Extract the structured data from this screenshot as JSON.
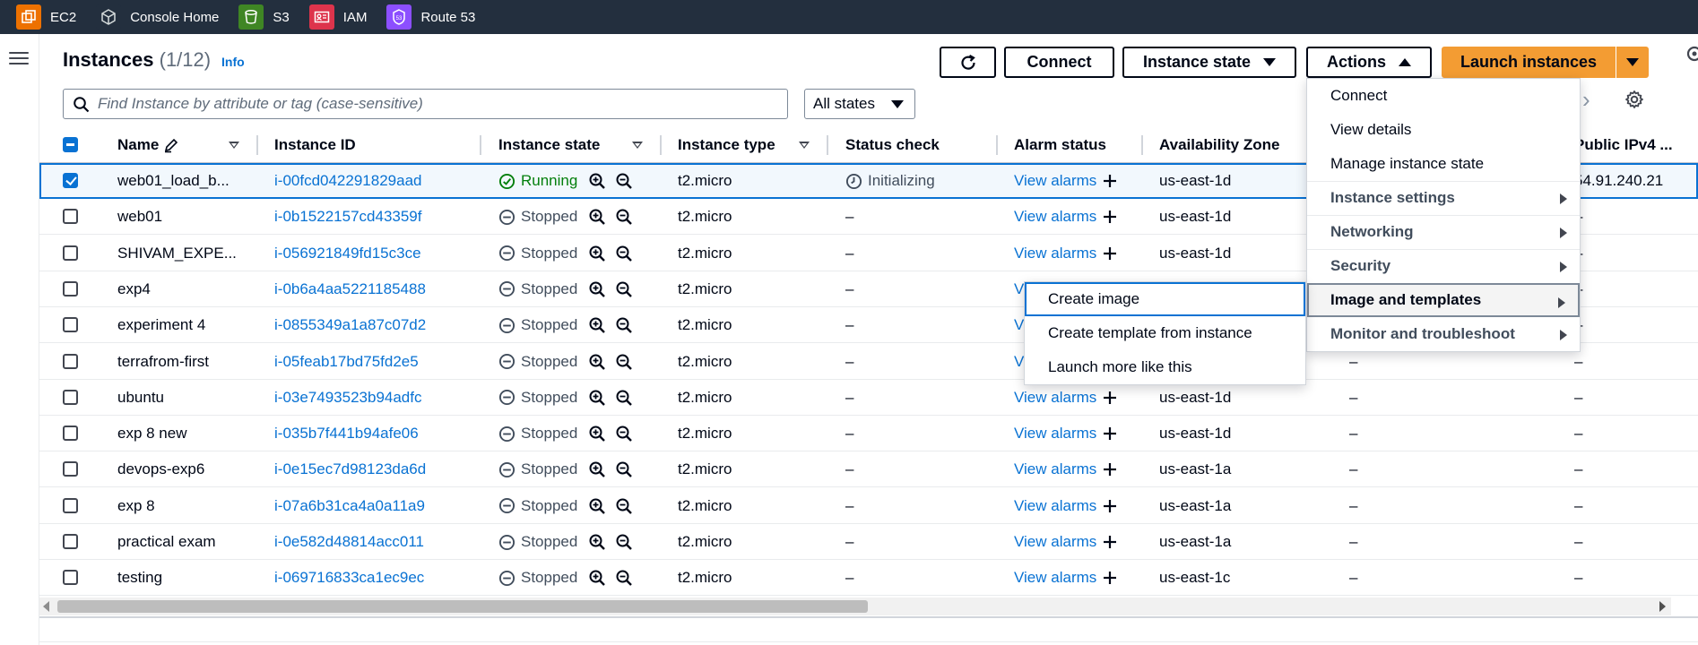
{
  "favorites": [
    {
      "label": "EC2",
      "icon": "ec2-icon",
      "color": "#ed7100"
    },
    {
      "label": "Console Home",
      "icon": "console-home-icon",
      "color": "#232f3e"
    },
    {
      "label": "S3",
      "icon": "s3-icon",
      "color": "#3f8624"
    },
    {
      "label": "IAM",
      "icon": "iam-icon",
      "color": "#dd344c"
    },
    {
      "label": "Route 53",
      "icon": "route53-icon",
      "color": "#8c4fff"
    }
  ],
  "header": {
    "title": "Instances",
    "count": "(1/12)",
    "info": "Info",
    "connect": "Connect",
    "instance_state": "Instance state",
    "actions": "Actions",
    "launch": "Launch instances"
  },
  "search": {
    "placeholder": "Find Instance by attribute or tag (case-sensitive)"
  },
  "filter": {
    "selected": "All states"
  },
  "columns": [
    "Name",
    "Instance ID",
    "Instance state",
    "Instance type",
    "Status check",
    "Alarm status",
    "Availability Zone",
    "Public IPv4 ..."
  ],
  "rows": [
    {
      "name": "web01_load_b...",
      "id": "i-00fcd042291829aad",
      "state": "Running",
      "type": "t2.micro",
      "status": "Initializing",
      "alarm": "View alarms",
      "az": "us-east-1d",
      "ip": "54.91.240.21",
      "selected": true
    },
    {
      "name": "web01",
      "id": "i-0b1522157cd43359f",
      "state": "Stopped",
      "type": "t2.micro",
      "status": "–",
      "alarm": "View alarms",
      "az": "us-east-1d",
      "ip": "–"
    },
    {
      "name": "SHIVAM_EXPE...",
      "id": "i-056921849fd15c3ce",
      "state": "Stopped",
      "type": "t2.micro",
      "status": "–",
      "alarm": "View alarms",
      "az": "us-east-1d",
      "ip": "–"
    },
    {
      "name": "exp4",
      "id": "i-0b6a4aa5221185488",
      "state": "Stopped",
      "type": "t2.micro",
      "status": "–",
      "alarm": "View alarms",
      "az": "",
      "ip": "–"
    },
    {
      "name": "experiment 4",
      "id": "i-0855349a1a87c07d2",
      "state": "Stopped",
      "type": "t2.micro",
      "status": "–",
      "alarm": "View alarms",
      "az": "",
      "ip": "–"
    },
    {
      "name": "terrafrom-first",
      "id": "i-05feab17bd75fd2e5",
      "state": "Stopped",
      "type": "t2.micro",
      "status": "–",
      "alarm": "View alarms",
      "az": "",
      "ip": "–"
    },
    {
      "name": "ubuntu",
      "id": "i-03e7493523b94adfc",
      "state": "Stopped",
      "type": "t2.micro",
      "status": "–",
      "alarm": "View alarms",
      "az": "us-east-1d",
      "ip": "–"
    },
    {
      "name": "exp 8 new",
      "id": "i-035b7f441b94afe06",
      "state": "Stopped",
      "type": "t2.micro",
      "status": "–",
      "alarm": "View alarms",
      "az": "us-east-1d",
      "ip": "–"
    },
    {
      "name": "devops-exp6",
      "id": "i-0e15ec7d98123da6d",
      "state": "Stopped",
      "type": "t2.micro",
      "status": "–",
      "alarm": "View alarms",
      "az": "us-east-1a",
      "ip": "–"
    },
    {
      "name": "exp 8",
      "id": "i-07a6b31ca4a0a11a9",
      "state": "Stopped",
      "type": "t2.micro",
      "status": "–",
      "alarm": "View alarms",
      "az": "us-east-1a",
      "ip": "–"
    },
    {
      "name": "practical exam",
      "id": "i-0e582d48814acc011",
      "state": "Stopped",
      "type": "t2.micro",
      "status": "–",
      "alarm": "View alarms",
      "az": "us-east-1a",
      "ip": "–"
    },
    {
      "name": "testing",
      "id": "i-069716833ca1ec9ec",
      "state": "Stopped",
      "type": "t2.micro",
      "status": "–",
      "alarm": "View alarms",
      "az": "us-east-1c",
      "ip": "–"
    }
  ],
  "az_extra": [
    "–",
    "–",
    "–",
    "–",
    "–",
    "–",
    "–",
    "–",
    "–",
    "–",
    "–"
  ],
  "actions_menu": {
    "items": [
      {
        "label": "Connect",
        "group": false
      },
      {
        "label": "View details",
        "group": false
      },
      {
        "label": "Manage instance state",
        "group": false
      },
      {
        "label": "Instance settings",
        "group": true
      },
      {
        "label": "Networking",
        "group": true
      },
      {
        "label": "Security",
        "group": true
      },
      {
        "label": "Image and templates",
        "group": true,
        "active": true
      },
      {
        "label": "Monitor and troubleshoot",
        "group": true
      }
    ]
  },
  "submenu": {
    "items": [
      "Create image",
      "Create template from instance",
      "Launch more like this"
    ]
  },
  "colors": {
    "link": "#0972d3",
    "running": "#037f0c",
    "primary": "#f39c33",
    "topbar": "#232f3e"
  }
}
